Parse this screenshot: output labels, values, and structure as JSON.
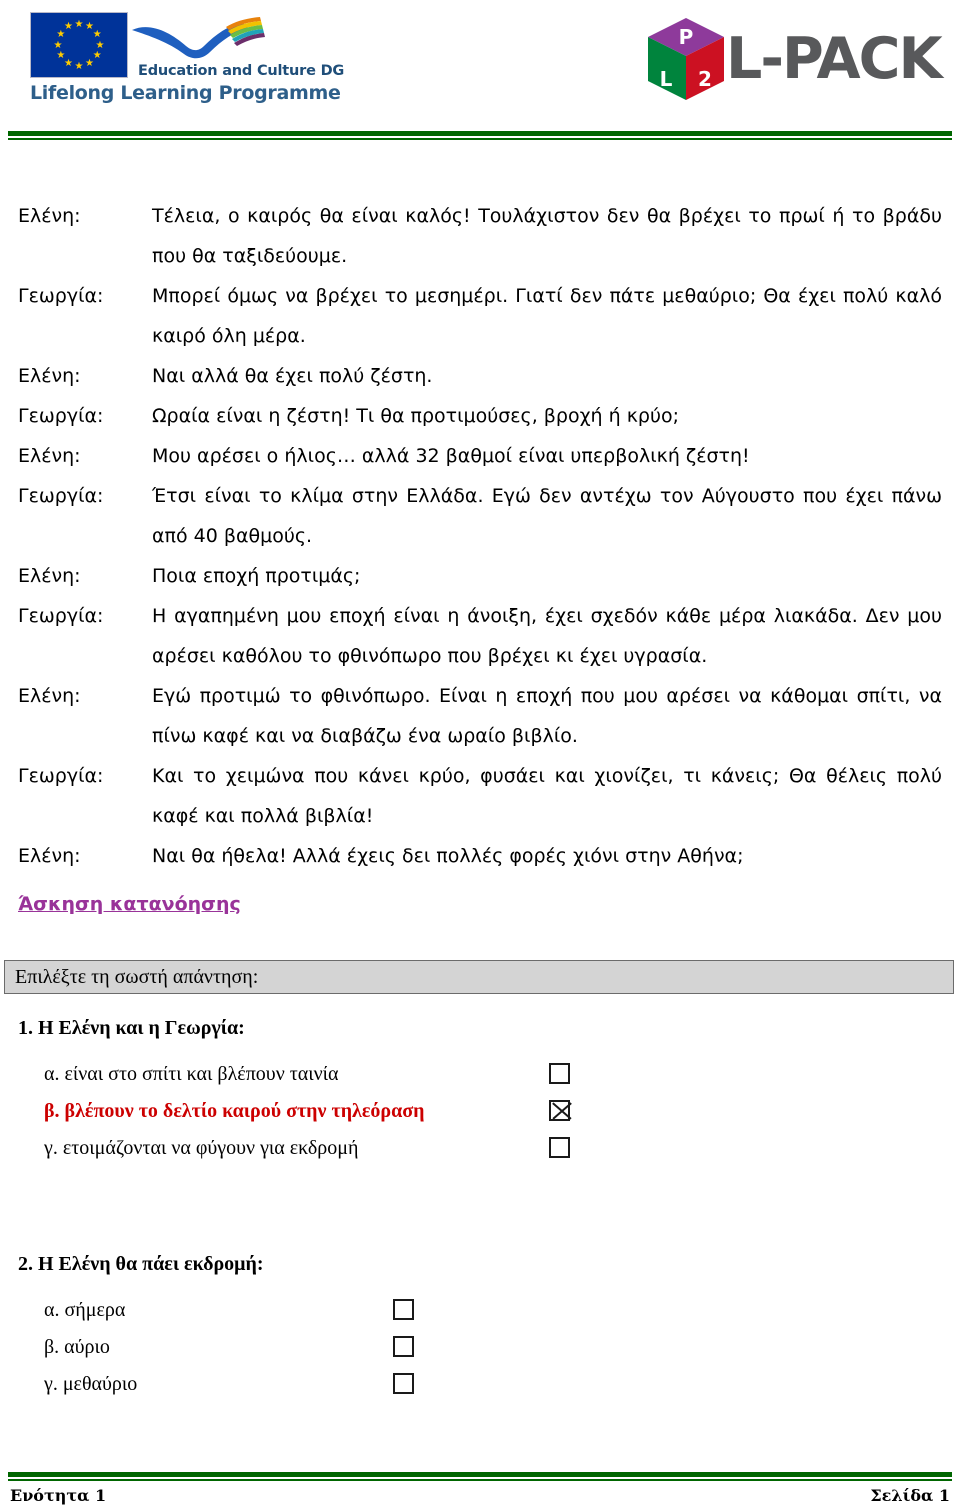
{
  "header": {
    "llp": {
      "eu_flag_alt": "european-union-flag",
      "dg_line": "Education and Culture DG",
      "programme_line": "Lifelong Learning Programme",
      "flag_color": "#003399",
      "star_color": "#FFCC00",
      "text_color": "#2E5F8A"
    },
    "lpack": {
      "wordmark": "L-PACK",
      "cube_faces": [
        {
          "letter": "P",
          "color": "#8E3A9B"
        },
        {
          "letter": "L",
          "color": "#00843D"
        },
        {
          "letter": "2",
          "color": "#CC1122"
        }
      ],
      "wordmark_color": "#58595B"
    },
    "rule_color": "#006600"
  },
  "dialogue": [
    {
      "speaker": "Ελένη:",
      "text": "Τέλεια, ο καιρός θα είναι καλός! Τουλάχιστον δεν θα βρέχει το πρωί ή το βράδυ που θα ταξιδεύουμε."
    },
    {
      "speaker": "Γεωργία:",
      "text": "Μπορεί όμως να βρέχει το μεσημέρι. Γιατί δεν πάτε μεθαύριο; Θα έχει πολύ καλό καιρό όλη μέρα."
    },
    {
      "speaker": "Ελένη:",
      "text": "Ναι αλλά θα έχει πολύ ζέστη."
    },
    {
      "speaker": "Γεωργία:",
      "text": "Ωραία είναι η ζέστη! Τι θα προτιμούσες, βροχή ή κρύο;"
    },
    {
      "speaker": "Ελένη:",
      "text": "Μου αρέσει ο ήλιος… αλλά 32 βαθμοί είναι υπερβολική ζέστη!"
    },
    {
      "speaker": "Γεωργία:",
      "text": "Έτσι είναι το κλίμα στην Ελλάδα. Εγώ δεν αντέχω τον Αύγουστο που έχει πάνω από 40 βαθμούς."
    },
    {
      "speaker": "Ελένη:",
      "text": "Ποια εποχή προτιμάς;"
    },
    {
      "speaker": "Γεωργία:",
      "text": "Η αγαπημένη μου εποχή είναι η άνοιξη, έχει σχεδόν κάθε μέρα λιακάδα. Δεν μου αρέσει καθόλου το φθινόπωρο που βρέχει κι έχει υγρασία."
    },
    {
      "speaker": "Ελένη:",
      "text": "Εγώ προτιμώ το φθινόπωρο. Είναι η εποχή που μου αρέσει να κάθομαι σπίτι, να πίνω καφέ και να διαβάζω ένα ωραίο βιβλίο."
    },
    {
      "speaker": "Γεωργία:",
      "text": "Και το χειμώνα που κάνει κρύο, φυσάει και χιονίζει, τι κάνεις; Θα θέλεις πολύ καφέ και πολλά βιβλία!"
    },
    {
      "speaker": "Ελένη:",
      "text": "Ναι θα ήθελα! Αλλά έχεις δει πολλές φορές χιόνι στην Αθήνα;"
    }
  ],
  "exercise": {
    "section_title": "Άσκηση κατανόησης",
    "section_title_color": "#993399",
    "instruction": "Επιλέξτε τη σωστή απάντηση:",
    "instruction_bg": "#D4D4D4",
    "highlight_color": "#CC0000",
    "questions": [
      {
        "title": "1. Η Ελένη και η Γεωργία:",
        "options": [
          {
            "label": "α. είναι στο σπίτι και βλέπουν ταινία",
            "checked": false,
            "highlight": false
          },
          {
            "label": "β. βλέπουν το δελτίο καιρού στην τηλεόραση",
            "checked": true,
            "highlight": true
          },
          {
            "label": "γ.  ετοιμάζονται να φύγουν για εκδρομή",
            "checked": false,
            "highlight": false
          }
        ]
      },
      {
        "title": "2. Η Ελένη θα πάει εκδρομή:",
        "options": [
          {
            "label": "α. σήμερα",
            "checked": false,
            "highlight": false
          },
          {
            "label": "β. αύριο",
            "checked": false,
            "highlight": false
          },
          {
            "label": "γ.  μεθαύριο",
            "checked": false,
            "highlight": false
          }
        ]
      }
    ]
  },
  "footer": {
    "left": "Ενότητα 1",
    "right": "Σελίδα 1",
    "rule_color": "#006600"
  }
}
